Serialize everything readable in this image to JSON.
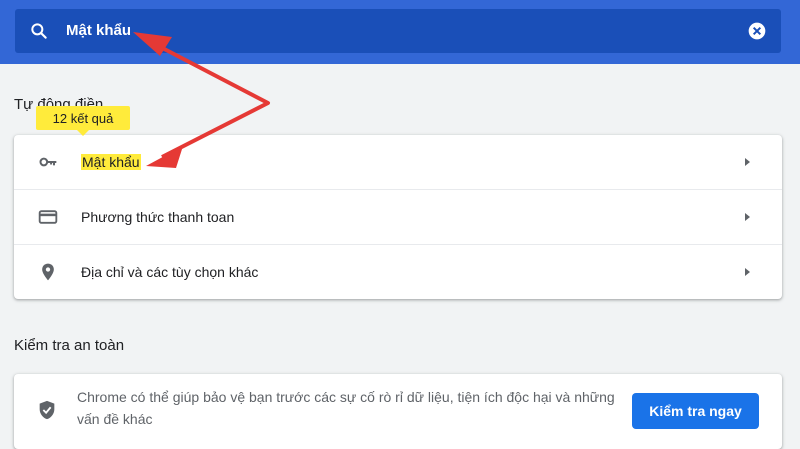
{
  "search": {
    "query": "Mật khẩu"
  },
  "autofill": {
    "section_title": "Tự động điền",
    "result_badge": "12 kết quả",
    "items": [
      {
        "label": "Mật khẩu",
        "icon": "key-icon",
        "highlighted": true
      },
      {
        "label": "Phương thức thanh toan",
        "icon": "credit-card-icon",
        "highlighted": false
      },
      {
        "label": "Địa chỉ và các tùy chọn khác",
        "icon": "location-pin-icon",
        "highlighted": false
      }
    ]
  },
  "safety_check": {
    "section_title": "Kiểm tra an toàn",
    "description": "Chrome có thể giúp bảo vệ bạn trước các sự cố rò rỉ dữ liệu, tiện ích độc hại và những vấn đề khác",
    "button_label": "Kiểm tra ngay",
    "icon": "shield-icon"
  },
  "colors": {
    "header": "#3367d6",
    "search_field": "#1a4fb8",
    "highlight": "#ffeb3b",
    "annotation_arrow": "#e53935",
    "button": "#1a73e8"
  }
}
